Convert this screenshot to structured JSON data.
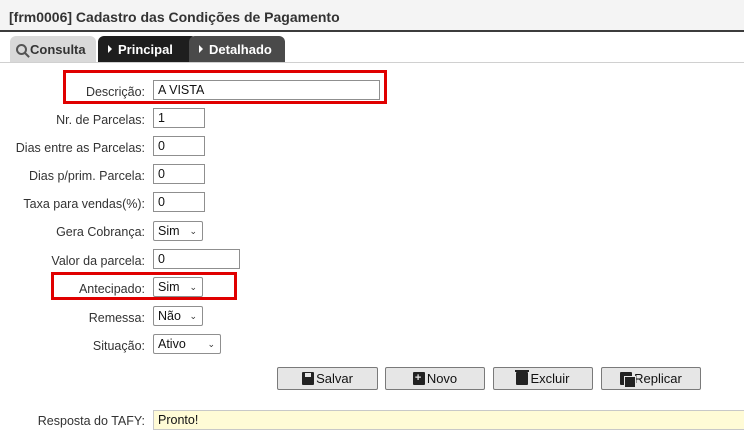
{
  "window": {
    "title": "[frm0006] Cadastro das Condições de Pagamento"
  },
  "tabs": [
    {
      "label": "Consulta",
      "icon": "magnifier-icon"
    },
    {
      "label": "Principal",
      "icon": "caret-right-icon"
    },
    {
      "label": "Detalhado",
      "icon": "caret-right-icon"
    }
  ],
  "form": {
    "descricao": {
      "label": "Descrição:",
      "value": "A VISTA"
    },
    "nr_parcelas": {
      "label": "Nr. de Parcelas:",
      "value": "1"
    },
    "dias_entre": {
      "label": "Dias entre as Parcelas:",
      "value": "0"
    },
    "dias_prim": {
      "label": "Dias p/prim. Parcela:",
      "value": "0"
    },
    "taxa": {
      "label": "Taxa para vendas(%):",
      "value": "0"
    },
    "gera_cobranca": {
      "label": "Gera Cobrança:",
      "value": "Sim"
    },
    "valor_parcela": {
      "label": "Valor da parcela:",
      "value": "0"
    },
    "antecipado": {
      "label": "Antecipado:",
      "value": "Sim"
    },
    "remessa": {
      "label": "Remessa:",
      "value": "Não"
    },
    "situacao": {
      "label": "Situação:",
      "value": "Ativo"
    }
  },
  "buttons": {
    "salvar": "Salvar",
    "novo": "Novo",
    "excluir": "Excluir",
    "replicar": "Replicar"
  },
  "response": {
    "label": "Resposta do TAFY:",
    "value": "Pronto!"
  },
  "colors": {
    "highlight": "#e00000",
    "active_tab": "#1e1e1e",
    "response_bg": "#fffbd6"
  }
}
